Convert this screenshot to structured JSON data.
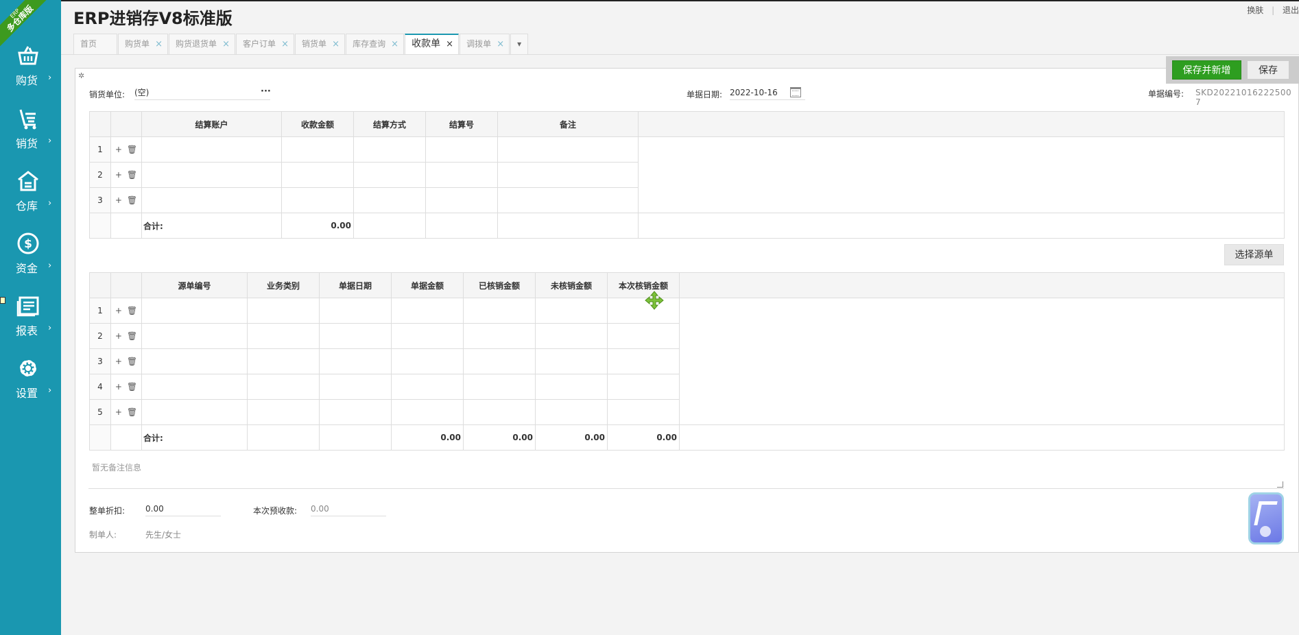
{
  "sidebar": {
    "ribbon_small": "ERP",
    "ribbon_text": "多仓库版",
    "items": [
      {
        "label": "购货",
        "icon": "basket-icon"
      },
      {
        "label": "销货",
        "icon": "cart-icon"
      },
      {
        "label": "仓库",
        "icon": "warehouse-icon"
      },
      {
        "label": "资金",
        "icon": "dollar-icon"
      },
      {
        "label": "报表",
        "icon": "report-icon"
      },
      {
        "label": "设置",
        "icon": "gear-icon"
      }
    ],
    "chevron": "›"
  },
  "header": {
    "title": "ERP进销存V8标准版",
    "links": [
      "换肤",
      "退出"
    ],
    "sep": "|"
  },
  "tabs": [
    {
      "label": "首页",
      "closable": false
    },
    {
      "label": "购货单",
      "closable": true
    },
    {
      "label": "购货退货单",
      "closable": true
    },
    {
      "label": "客户订单",
      "closable": true
    },
    {
      "label": "销货单",
      "closable": true
    },
    {
      "label": "库存查询",
      "closable": true
    },
    {
      "label": "收款单",
      "closable": true,
      "active": true
    },
    {
      "label": "调拨单",
      "closable": true
    }
  ],
  "tab_close": "×",
  "tab_more": "▾",
  "form": {
    "gear": "✲",
    "unit_label": "销货单位:",
    "unit_value": "(空)",
    "ellipsis": "···",
    "date_label": "单据日期:",
    "date_value": "2022-10-16",
    "number_label": "单据编号:",
    "number_value": "SKD20221016222500 7"
  },
  "actions": {
    "save_new": "保存并新增",
    "save": "保存"
  },
  "grid1": {
    "headers": [
      "结算账户",
      "收款金额",
      "结算方式",
      "结算号",
      "备注"
    ],
    "rows": [
      "1",
      "2",
      "3"
    ],
    "total_label": "合计:",
    "total_amount": "0.00"
  },
  "select_source": "选择源单",
  "grid2": {
    "headers": [
      "源单编号",
      "业务类别",
      "单据日期",
      "单据金额",
      "已核销金额",
      "未核销金额",
      "本次核销金额"
    ],
    "rows": [
      "1",
      "2",
      "3",
      "4",
      "5"
    ],
    "total_label": "合计:",
    "totals": [
      "0.00",
      "0.00",
      "0.00",
      "0.00"
    ]
  },
  "ops": {
    "plus": "+",
    "trash": "🗑"
  },
  "remark": "暂无备注信息",
  "footer": {
    "discount_label": "整单折扣:",
    "discount_value": "0.00",
    "prepay_label": "本次预收款:",
    "prepay_value": "0.00",
    "maker_label": "制单人:",
    "maker_value": "先生/女士"
  }
}
